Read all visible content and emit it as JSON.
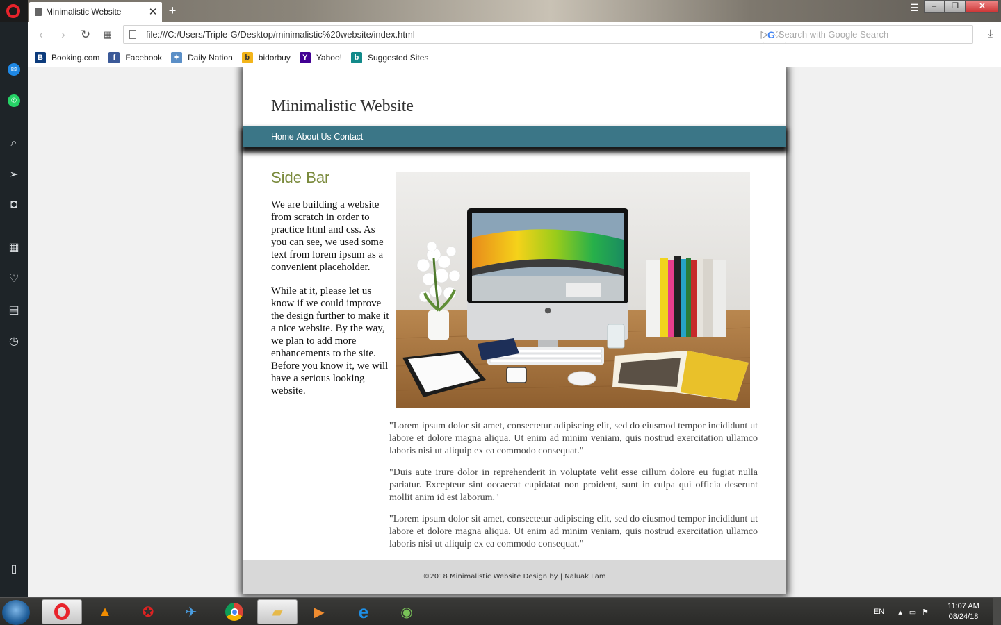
{
  "browser": {
    "tab_title": "Minimalistic Website",
    "url": "file:///C:/Users/Triple-G/Desktop/minimalistic%20website/index.html",
    "search_placeholder": "Search with Google Search",
    "bookmarks": [
      {
        "label": "Booking.com",
        "icon": "B",
        "color": "#0c3b7c"
      },
      {
        "label": "Facebook",
        "icon": "f",
        "color": "#3b5998"
      },
      {
        "label": "Daily Nation",
        "icon": "✦",
        "color": "#5b8fc7"
      },
      {
        "label": "bidorbuy",
        "icon": "b",
        "color": "#f3b51b"
      },
      {
        "label": "Yahoo!",
        "icon": "Y",
        "color": "#410093"
      },
      {
        "label": "Suggested Sites",
        "icon": "b",
        "color": "#128a8a"
      }
    ]
  },
  "site": {
    "title": "Minimalistic Website",
    "nav": [
      "Home",
      "About Us",
      "Contact"
    ],
    "sidebar_title": "Side Bar",
    "sidebar_p1": "We are building a website from scratch in order to practice html and css. As you can see, we used some text from lorem ipsum as a convenient placeholder.",
    "sidebar_p2": "While at it, please let us know if we could improve the design further to make it a nice website. By the way, we plan to add more enhancements to the site. Before you know it, we will have a serious looking website.",
    "paragraphs": [
      "\"Lorem ipsum dolor sit amet, consectetur adipiscing elit, sed do eiusmod tempor incididunt ut labore et dolore magna aliqua. Ut enim ad minim veniam, quis nostrud exercitation ullamco laboris nisi ut aliquip ex ea commodo consequat.\"",
      "\"Duis aute irure dolor in reprehenderit in voluptate velit esse cillum dolore eu fugiat nulla pariatur. Excepteur sint occaecat cupidatat non proident, sunt in culpa qui officia deserunt mollit anim id est laborum.\"",
      "\"Lorem ipsum dolor sit amet, consectetur adipiscing elit, sed do eiusmod tempor incididunt ut labore et dolore magna aliqua. Ut enim ad minim veniam, quis nostrud exercitation ullamco laboris nisi ut aliquip ex ea commodo consequat.\""
    ],
    "footer": "©2018 Minimalistic Website Design by | Naluak Lam",
    "nav_color": "#3b7687",
    "accent_color": "#7a8a3c"
  },
  "taskbar": {
    "language": "EN",
    "time": "11:07 AM",
    "date": "08/24/18"
  }
}
